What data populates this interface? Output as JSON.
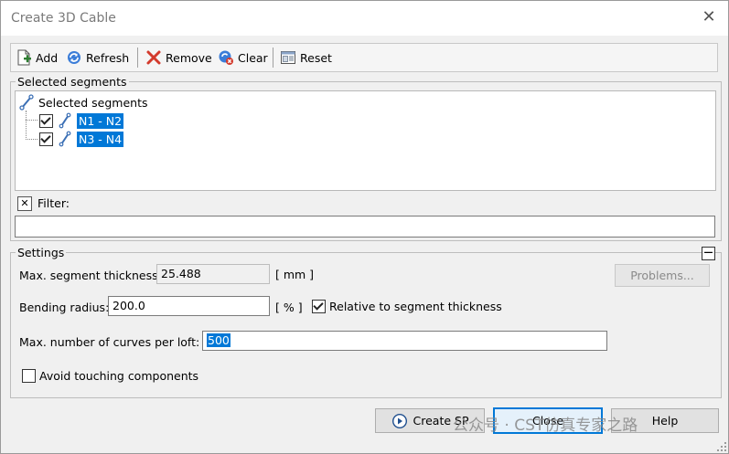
{
  "window": {
    "title": "Create 3D Cable",
    "close_glyph": "✕"
  },
  "toolbar": {
    "add_label": "Add",
    "refresh_label": "Refresh",
    "remove_label": "Remove",
    "clear_label": "Clear",
    "reset_label": "Reset"
  },
  "selected_segments": {
    "group_label": "Selected segments",
    "root_label": "Selected segments",
    "items": [
      {
        "label": "N1 - N2",
        "checked": true
      },
      {
        "label": "N3 - N4",
        "checked": true
      }
    ]
  },
  "filter": {
    "label": "Filter:",
    "glyph": "✕",
    "value": ""
  },
  "settings": {
    "group_label": "Settings",
    "collapse_glyph": "—",
    "max_thickness_label": "Max. segment thickness:",
    "max_thickness_value": "25.488",
    "max_thickness_unit": "[ mm ]",
    "problems_label": "Problems...",
    "bending_label": "Bending radius:",
    "bending_value": "200.0",
    "bending_unit": "[ % ]",
    "relative_label": "Relative to segment thickness",
    "relative_checked": true,
    "curves_label": "Max. number of curves per loft:",
    "curves_value": "500",
    "avoid_label": "Avoid touching components",
    "avoid_checked": false
  },
  "footer": {
    "create_label": "Create SP",
    "close_label": "Close",
    "help_label": "Help"
  },
  "watermark": "公众号 · CST仿真专家之路",
  "colors": {
    "selection": "#0078d7",
    "accent_blue": "#1a5fb4",
    "remove_red": "#d33a2c"
  }
}
